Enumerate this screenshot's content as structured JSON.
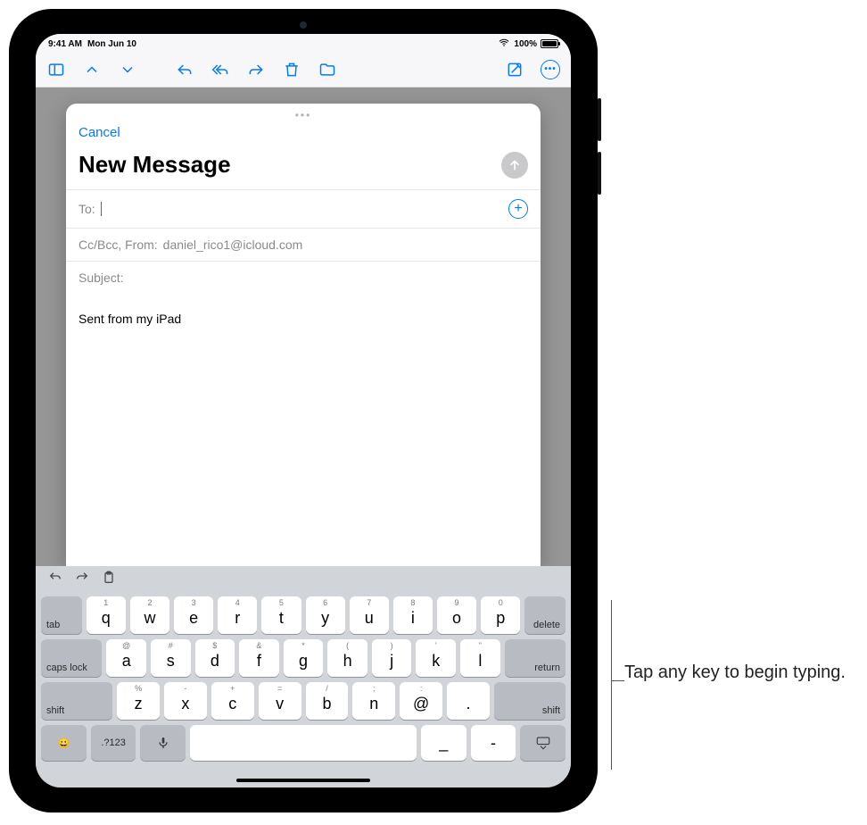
{
  "status": {
    "time": "9:41 AM",
    "date": "Mon Jun 10",
    "battery": "100%"
  },
  "toolbar": {
    "sidebar_icon": "sidebar-icon",
    "up_icon": "chevron-up-icon",
    "down_icon": "chevron-down-icon",
    "reply_icon": "reply-icon",
    "reply_all_icon": "reply-all-icon",
    "forward_icon": "forward-icon",
    "trash_icon": "trash-icon",
    "folder_icon": "folder-icon",
    "compose_icon": "compose-icon",
    "more_icon": "more-icon"
  },
  "compose": {
    "cancel_label": "Cancel",
    "title": "New Message",
    "to_label": "To:",
    "ccbcc_label": "Cc/Bcc, From:",
    "from_value": "daniel_rico1@icloud.com",
    "subject_label": "Subject:",
    "signature": "Sent from my iPad"
  },
  "keyboard": {
    "row1": [
      {
        "main": "q",
        "alt": "1"
      },
      {
        "main": "w",
        "alt": "2"
      },
      {
        "main": "e",
        "alt": "3"
      },
      {
        "main": "r",
        "alt": "4"
      },
      {
        "main": "t",
        "alt": "5"
      },
      {
        "main": "y",
        "alt": "6"
      },
      {
        "main": "u",
        "alt": "7"
      },
      {
        "main": "i",
        "alt": "8"
      },
      {
        "main": "o",
        "alt": "9"
      },
      {
        "main": "p",
        "alt": "0"
      }
    ],
    "row2": [
      {
        "main": "a",
        "alt": "@"
      },
      {
        "main": "s",
        "alt": "#"
      },
      {
        "main": "d",
        "alt": "$"
      },
      {
        "main": "f",
        "alt": "&"
      },
      {
        "main": "g",
        "alt": "*"
      },
      {
        "main": "h",
        "alt": "("
      },
      {
        "main": "j",
        "alt": ")"
      },
      {
        "main": "k",
        "alt": "'"
      },
      {
        "main": "l",
        "alt": "\""
      }
    ],
    "row3": [
      {
        "main": "z",
        "alt": "%"
      },
      {
        "main": "x",
        "alt": "-"
      },
      {
        "main": "c",
        "alt": "+"
      },
      {
        "main": "v",
        "alt": "="
      },
      {
        "main": "b",
        "alt": "/"
      },
      {
        "main": "n",
        "alt": ";"
      },
      {
        "main": "@",
        "alt": ":"
      },
      {
        "main": ".",
        "alt": ""
      }
    ],
    "tab": "tab",
    "delete": "delete",
    "caps": "caps lock",
    "return": "return",
    "shift": "shift",
    "numbers": ".?123",
    "underscore": "_",
    "dash": "-"
  },
  "callout": {
    "text": "Tap any key to begin typing."
  }
}
